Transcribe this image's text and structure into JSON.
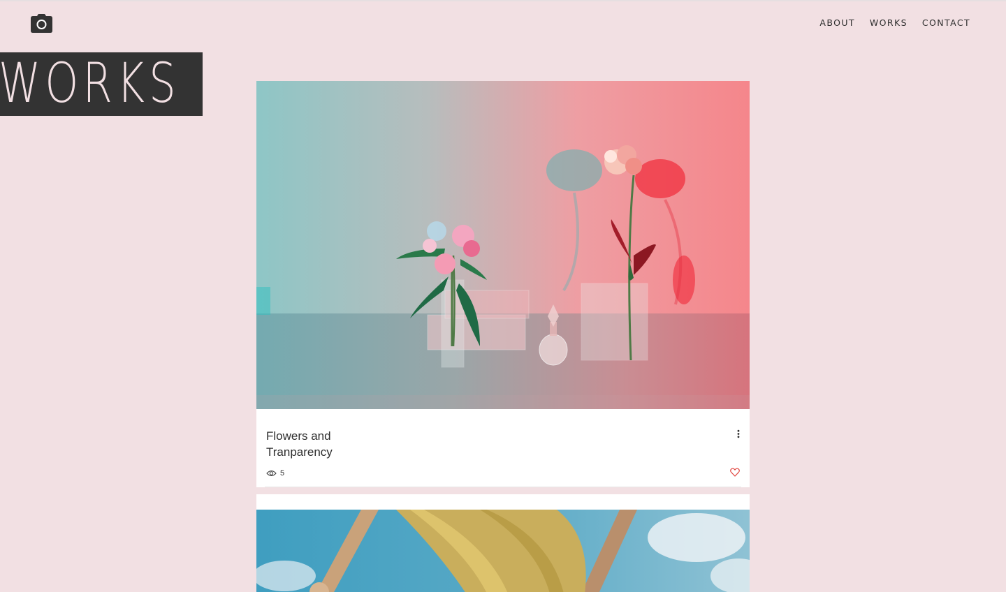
{
  "header": {
    "logo_icon": "camera-icon",
    "nav": [
      {
        "label": "ABOUT"
      },
      {
        "label": "WORKS"
      },
      {
        "label": "CONTACT"
      }
    ]
  },
  "page": {
    "heading": "WORKS"
  },
  "posts": [
    {
      "title_line1": "Flowers and",
      "title_line2": "Tranparency",
      "views": "5",
      "image_desc_icon": "photo",
      "view_icon": "eye-icon",
      "like_icon": "heart-icon",
      "more_icon": "more-vertical-icon"
    },
    {
      "image_desc_icon": "photo"
    }
  ],
  "colors": {
    "background": "#f2e0e3",
    "heading_block": "#333333",
    "like": "#e0453f"
  }
}
